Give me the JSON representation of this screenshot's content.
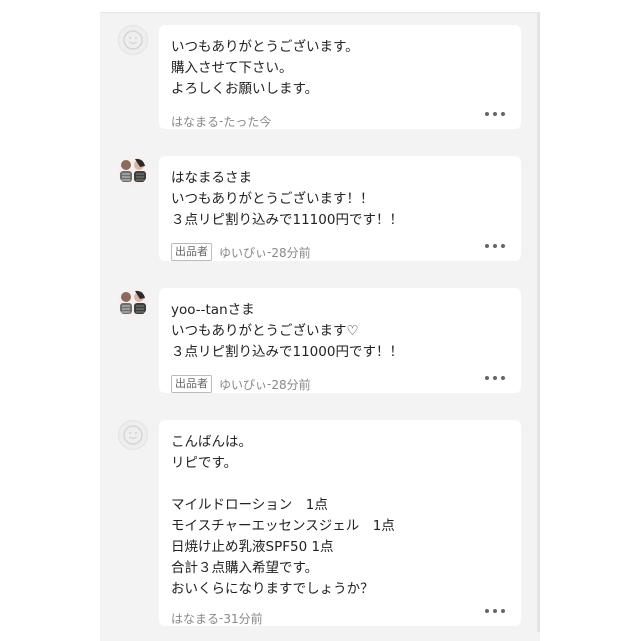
{
  "comments": [
    {
      "lines": [
        "いつもありがとうございます。",
        "購入させて下さい。",
        "よろしくお願いします。"
      ],
      "user": "はなまる",
      "time": "たった今",
      "is_seller": false,
      "avatar": "default-user-icon"
    },
    {
      "lines": [
        "はなまるさま",
        "いつもありがとうございます！！",
        "３点リピ割り込みで11100円です！！"
      ],
      "user": "ゆいぴぃ",
      "time": "28分前",
      "is_seller": true,
      "seller_badge": "出品者",
      "avatar": "user-photo"
    },
    {
      "lines": [
        "yoo--tanさま",
        "いつもありがとうございます♡",
        "３点リピ割り込みで11000円です！！"
      ],
      "user": "ゆいぴぃ",
      "time": "28分前",
      "is_seller": true,
      "seller_badge": "出品者",
      "avatar": "user-photo"
    },
    {
      "lines": [
        "こんばんは。",
        "リピです。",
        "",
        "マイルドローション　1点",
        "モイスチャーエッセンスジェル　1点",
        "日焼け止め乳液SPF50 1点",
        "合計３点購入希望です。",
        "おいくらになりますでしょうか？"
      ],
      "user": "はなまる",
      "time": "31分前",
      "is_seller": false,
      "avatar": "default-user-icon"
    }
  ],
  "meta_separator": " - ",
  "colors": {
    "panel": "#f3f3f3",
    "bubble": "#ffffff",
    "text": "#222222",
    "meta": "#888888"
  }
}
